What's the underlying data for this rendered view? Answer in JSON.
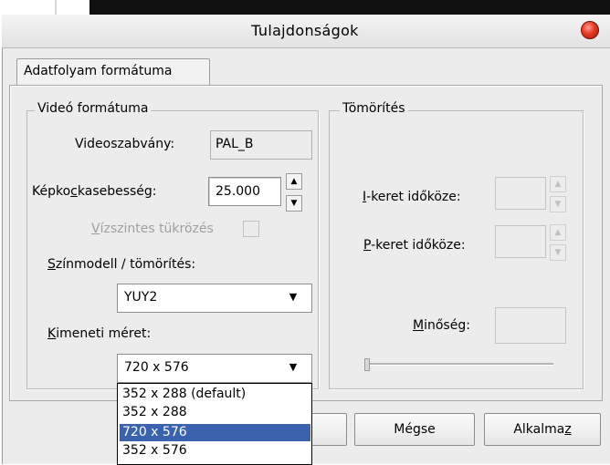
{
  "dialog": {
    "title": "Tulajdonságok",
    "close_icon": "close-icon"
  },
  "tab": {
    "label": "Adatfolyam formátuma"
  },
  "video_group": {
    "title": "Videó formátuma",
    "standard_label": "Videoszabvány:",
    "standard_value": "PAL_B",
    "framerate_label_pre": "Képko",
    "framerate_label_u": "c",
    "framerate_label_post": "kasebesség:",
    "framerate_value": "25.000",
    "mirror_label_u": "V",
    "mirror_label_post": "ízszintes tükrözés",
    "colormodel_label_u": "S",
    "colormodel_label_post": "zínmodell / tömörítés:",
    "colormodel_value": "YUY2",
    "output_label_u": "K",
    "output_label_post": "imeneti méret:",
    "output_value": "720 x 576",
    "output_options": [
      "352 x 288  (default)",
      "352 x 288",
      "720 x 576",
      "352 x 576"
    ],
    "output_selected_index": 2
  },
  "compression_group": {
    "title": "Tömörítés",
    "iframe_label_u": "I",
    "iframe_label_post": "-keret időköze:",
    "pframe_label_u": "P",
    "pframe_label_post": "-keret időköze:",
    "quality_label_u": "M",
    "quality_label_post": "inőség:"
  },
  "buttons": {
    "cancel": "Mégse",
    "apply_pre": "Alkalma",
    "apply_u": "z"
  },
  "colors": {
    "selection": "#3a62ad",
    "dialog_bg": "#ececec",
    "close": "#e23a22"
  }
}
